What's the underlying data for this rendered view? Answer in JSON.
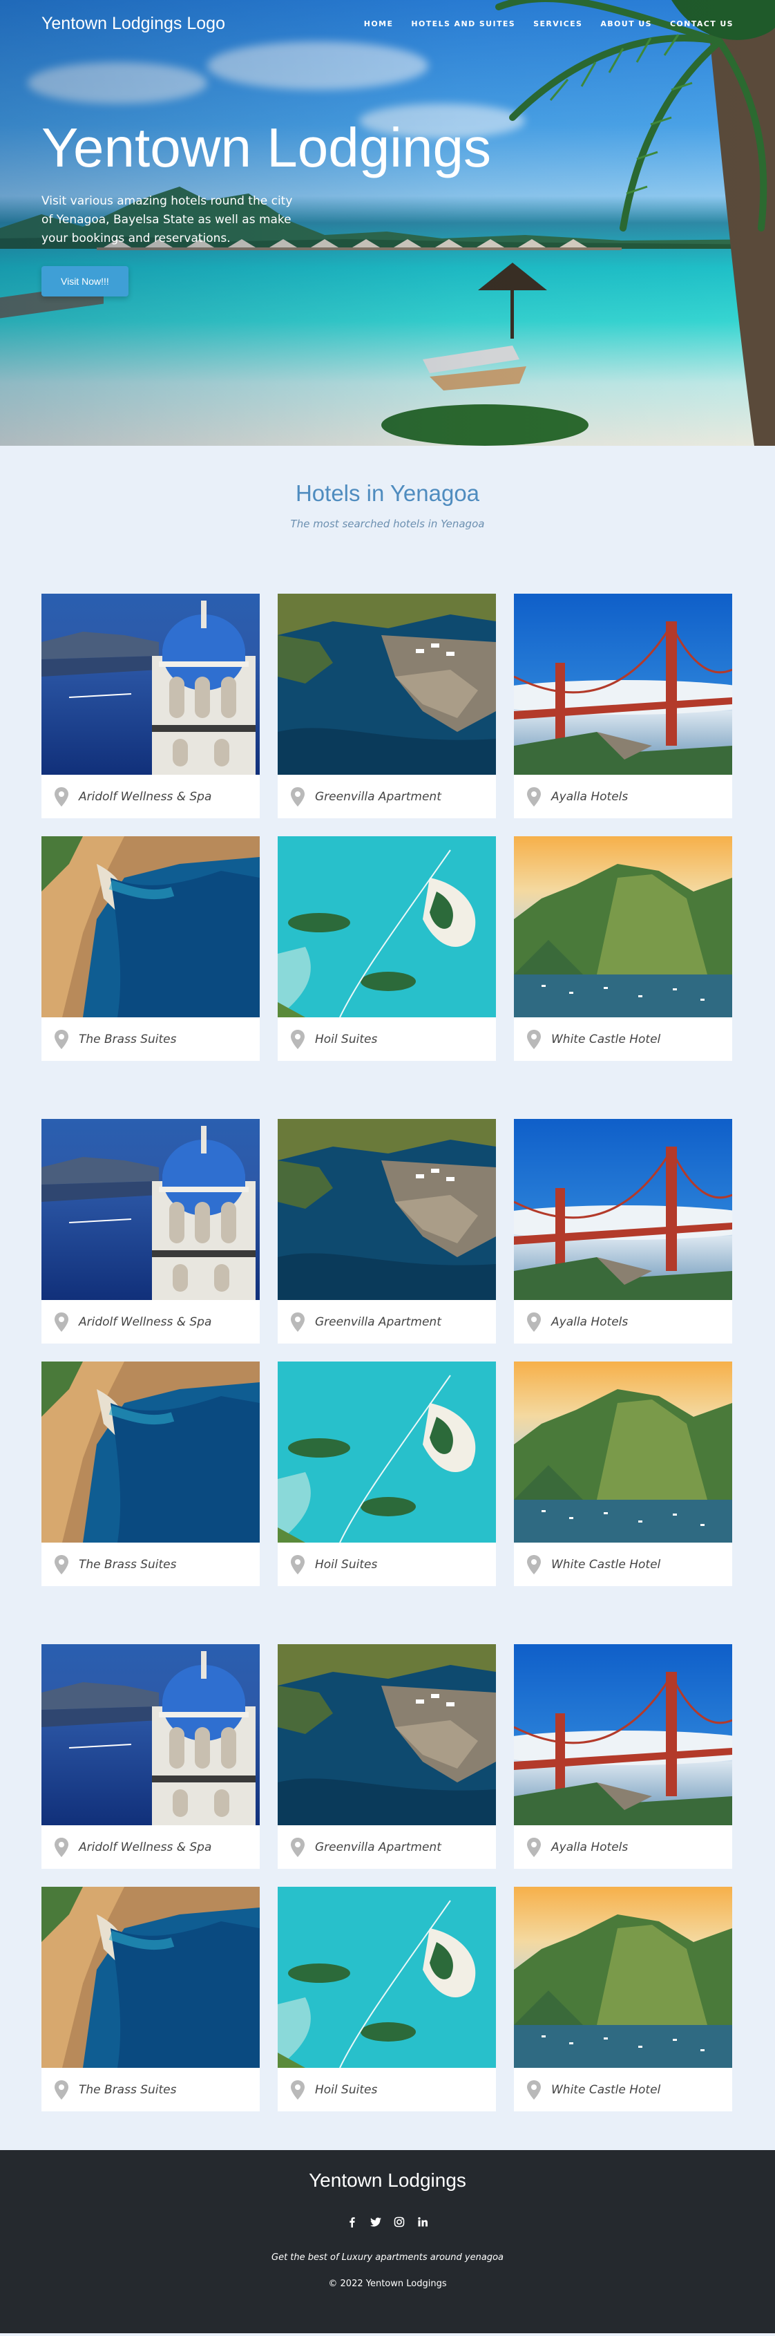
{
  "nav": {
    "logo": "Yentown Lodgings Logo",
    "links": [
      "HOME",
      "HOTELS AND SUITES",
      "SERVICES",
      "ABOUT US",
      "CONTACT US"
    ]
  },
  "hero": {
    "title": "Yentown Lodgings",
    "subtitle": "Visit various amazing hotels round the city of Yenagoa, Bayelsa State as well as make your bookings and reservations.",
    "button": "Visit Now!!!"
  },
  "section": {
    "title": "Hotels in Yenagoa",
    "subtitle": "The most searched hotels in Yenagoa"
  },
  "groups": [
    {
      "hotels": [
        {
          "name": "Aridolf Wellness & Spa",
          "image": "santorini-church"
        },
        {
          "name": "Greenvilla Apartment",
          "image": "cliff-harbor"
        },
        {
          "name": "Ayalla Hotels",
          "image": "golden-gate-bridge"
        },
        {
          "name": "The Brass Suites",
          "image": "navagio-beach"
        },
        {
          "name": "Hoil Suites",
          "image": "turquoise-lagoon"
        },
        {
          "name": "White Castle Hotel",
          "image": "karst-bay"
        }
      ]
    },
    {
      "hotels": [
        {
          "name": "Aridolf Wellness & Spa",
          "image": "santorini-church"
        },
        {
          "name": "Greenvilla Apartment",
          "image": "cliff-harbor"
        },
        {
          "name": "Ayalla Hotels",
          "image": "golden-gate-bridge"
        },
        {
          "name": "The Brass Suites",
          "image": "navagio-beach"
        },
        {
          "name": "Hoil Suites",
          "image": "turquoise-lagoon"
        },
        {
          "name": "White Castle Hotel",
          "image": "karst-bay"
        }
      ]
    },
    {
      "hotels": [
        {
          "name": "Aridolf Wellness & Spa",
          "image": "santorini-church"
        },
        {
          "name": "Greenvilla Apartment",
          "image": "cliff-harbor"
        },
        {
          "name": "Ayalla Hotels",
          "image": "golden-gate-bridge"
        },
        {
          "name": "The Brass Suites",
          "image": "navagio-beach"
        },
        {
          "name": "Hoil Suites",
          "image": "turquoise-lagoon"
        },
        {
          "name": "White Castle Hotel",
          "image": "karst-bay"
        }
      ]
    }
  ],
  "footer": {
    "title": "Yentown Lodgings",
    "social": [
      "facebook-icon",
      "twitter-icon",
      "instagram-icon",
      "linkedin-icon"
    ],
    "tagline": "Get the best of Luxury apartments around yenagoa",
    "copyright": "© 2022 Yentown Lodgings"
  },
  "colors": {
    "accent": "#4f8cbf",
    "button": "#3f9fd6",
    "page_bg": "#e9f0f9",
    "footer_bg": "#25292e"
  }
}
